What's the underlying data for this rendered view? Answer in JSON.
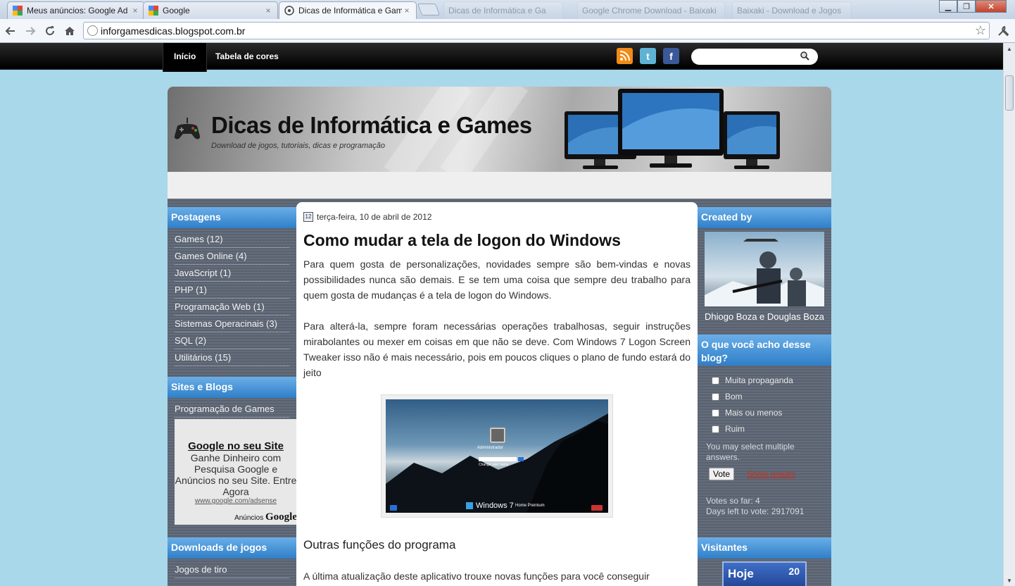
{
  "browser": {
    "tabs": [
      {
        "title": "Meus anúncios: Google Ad",
        "close": "×"
      },
      {
        "title": "Google",
        "close": "×"
      },
      {
        "title": "Dicas de Informática e Gam",
        "close": "×"
      },
      {
        "title": "Dicas de Informática e Ga",
        "close": "×"
      },
      {
        "title": "Google Chrome Download - Baixaki",
        "close": "×"
      },
      {
        "title": "Baixaki - Download e Jogos",
        "close": "×"
      }
    ],
    "window_controls": {
      "minimize": "▁",
      "maximize": "❐",
      "close": "✕"
    },
    "url": "inforgamesdicas.blogspot.com.br",
    "icons": {
      "back": "back-arrow-icon",
      "forward": "forward-arrow-icon",
      "reload": "reload-icon",
      "home": "home-icon",
      "star": "star-icon",
      "wrench": "wrench-icon"
    }
  },
  "blog": {
    "nav": {
      "home": "Início",
      "colors": "Tabela de cores"
    },
    "social": {
      "rss": "rss-icon",
      "twitter": "t",
      "facebook": "f"
    },
    "title": "Dicas de Informática e Games",
    "description": "Download de jogos, tutoriais, dicas e programação",
    "sidebar_left": {
      "postagens_title": "Postagens",
      "postagens": [
        "Games (12)",
        "Games Online (4)",
        "JavaScript (1)",
        "PHP (1)",
        "Programação Web (1)",
        "Sistemas Operacinais (3)",
        "SQL (2)",
        "Utilitários (15)"
      ],
      "sites_title": "Sites e Blogs",
      "sites": [
        "Programação de Games"
      ],
      "ad": {
        "title": "Google no seu Site",
        "text": "Ganhe Dinheiro com Pesquisa Google e Anúncios no seu Site. Entre Agora",
        "url": "www.google.com/adsense",
        "tag": "Anúncios",
        "brand": "Google"
      },
      "downloads_title": "Downloads de jogos",
      "downloads": [
        "Jogos de tiro"
      ]
    },
    "post": {
      "cal": "12",
      "date": "terça-feira, 10 de abril de 2012",
      "title": "Como mudar a tela de logon do Windows",
      "p1": "Para quem gosta de personalizações, novidades sempre são bem-vindas e novas possibilidades nunca são demais. E se tem uma coisa que sempre deu trabalho para quem gosta de mudanças é a tela de logon do Windows.",
      "p2": "Para alterá-la, sempre foram necessárias operações trabalhosas, seguir instruções mirabolantes ou mexer em coisas em que não se deve. Com Windows 7 Logon Screen Tweaker isso não é mais necessário, pois em poucos cliques o plano de fundo estará do jeito",
      "screenshot": {
        "user": "Administrador",
        "change": "Change user name",
        "brand": "Windows 7",
        "edition": "Home Premium"
      },
      "subtitle": "Outras funções do programa",
      "p3": "A última atualização deste aplicativo trouxe novas funções para você conseguir"
    },
    "sidebar_right": {
      "created_title": "Created by",
      "authors": "Dhiogo Boza e Douglas Boza",
      "poll_title": "O que você acho desse blog?",
      "options": [
        "Muita propaganda",
        "Bom",
        "Mais ou menos",
        "Ruim"
      ],
      "multi_note": "You may select multiple answers.",
      "vote": "Vote",
      "results": "Show results",
      "votes_so_far": "Votes so far: 4",
      "days_left": "Days left to vote: 2917091",
      "visitors_title": "Visitantes",
      "visitors_label": "Hoje",
      "visitors_count": "20"
    }
  }
}
